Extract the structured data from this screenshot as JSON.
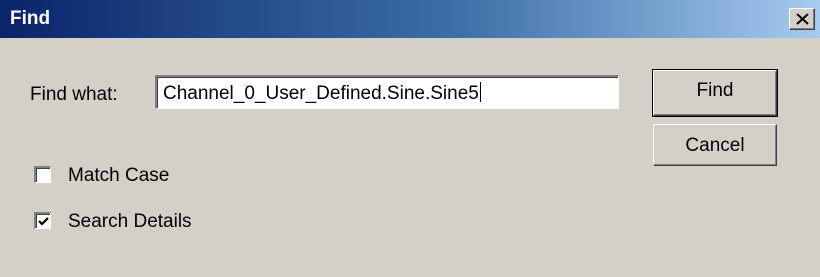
{
  "dialog": {
    "title": "Find",
    "close_glyph": "X"
  },
  "find_what": {
    "label": "Find what:",
    "value": "Channel_0_User_Defined.Sine.Sine5"
  },
  "buttons": {
    "find_label": "Find",
    "cancel_label": "Cancel"
  },
  "options": {
    "match_case": {
      "label": "Match Case",
      "checked": false
    },
    "search_details": {
      "label": "Search Details",
      "checked": true
    }
  },
  "colors": {
    "titlebar_start": "#0a246a",
    "titlebar_end": "#a6caf0",
    "dialog_face": "#d4d0c8"
  },
  "icons": {
    "close": "close-icon",
    "check": "checkmark-icon"
  }
}
